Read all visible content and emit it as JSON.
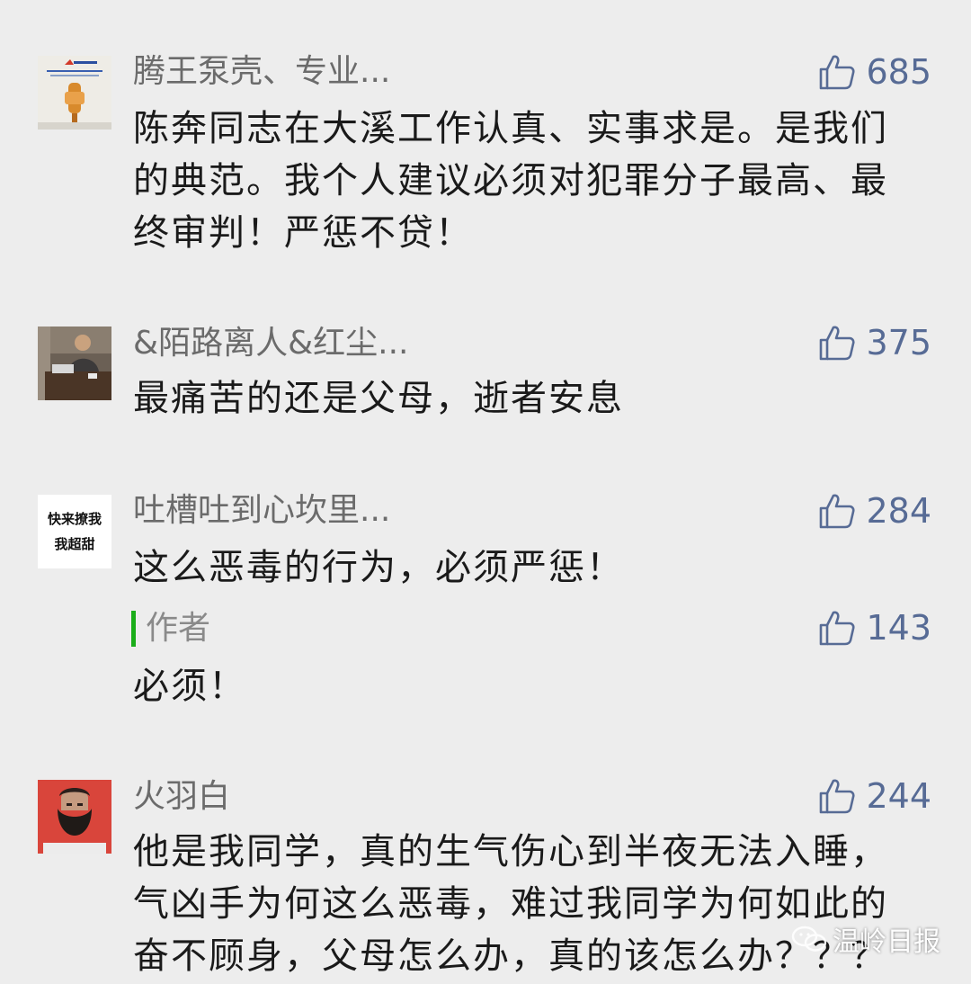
{
  "colors": {
    "background": "#ededed",
    "nickname": "#6b6b6b",
    "like": "#576b95",
    "text": "#1a1a1a",
    "author_bar": "#1aad19"
  },
  "comments": [
    {
      "nickname": "腾王泵壳、专业...",
      "likes": "685",
      "text": "陈奔同志在大溪工作认真、实事求是。是我们的典范。我个人建议必须对犯罪分子最高、最终审判！严惩不贷！",
      "avatar_icon": "pump-product-avatar"
    },
    {
      "nickname": "&陌路离人&红尘...",
      "likes": "375",
      "text": "最痛苦的还是父母，逝者安息",
      "avatar_icon": "man-at-desk-avatar"
    },
    {
      "nickname": "吐槽吐到心坎里...",
      "likes": "284",
      "text": "这么恶毒的行为，必须严惩！",
      "avatar_line1": "快来撩我",
      "avatar_line2": "我超甜",
      "reply": {
        "label": "作者",
        "likes": "143",
        "text": "必须！"
      }
    },
    {
      "nickname": "火羽白",
      "likes": "244",
      "text": "他是我同学，真的生气伤心到半夜无法入睡，气凶手为何这么恶毒，难过我同学为何如此的奋不顾身，父母怎么办，真的该怎么办？？？",
      "avatar_icon": "bearded-man-avatar"
    }
  ],
  "watermark": {
    "text": "温岭日报",
    "icon": "wechat-icon"
  }
}
